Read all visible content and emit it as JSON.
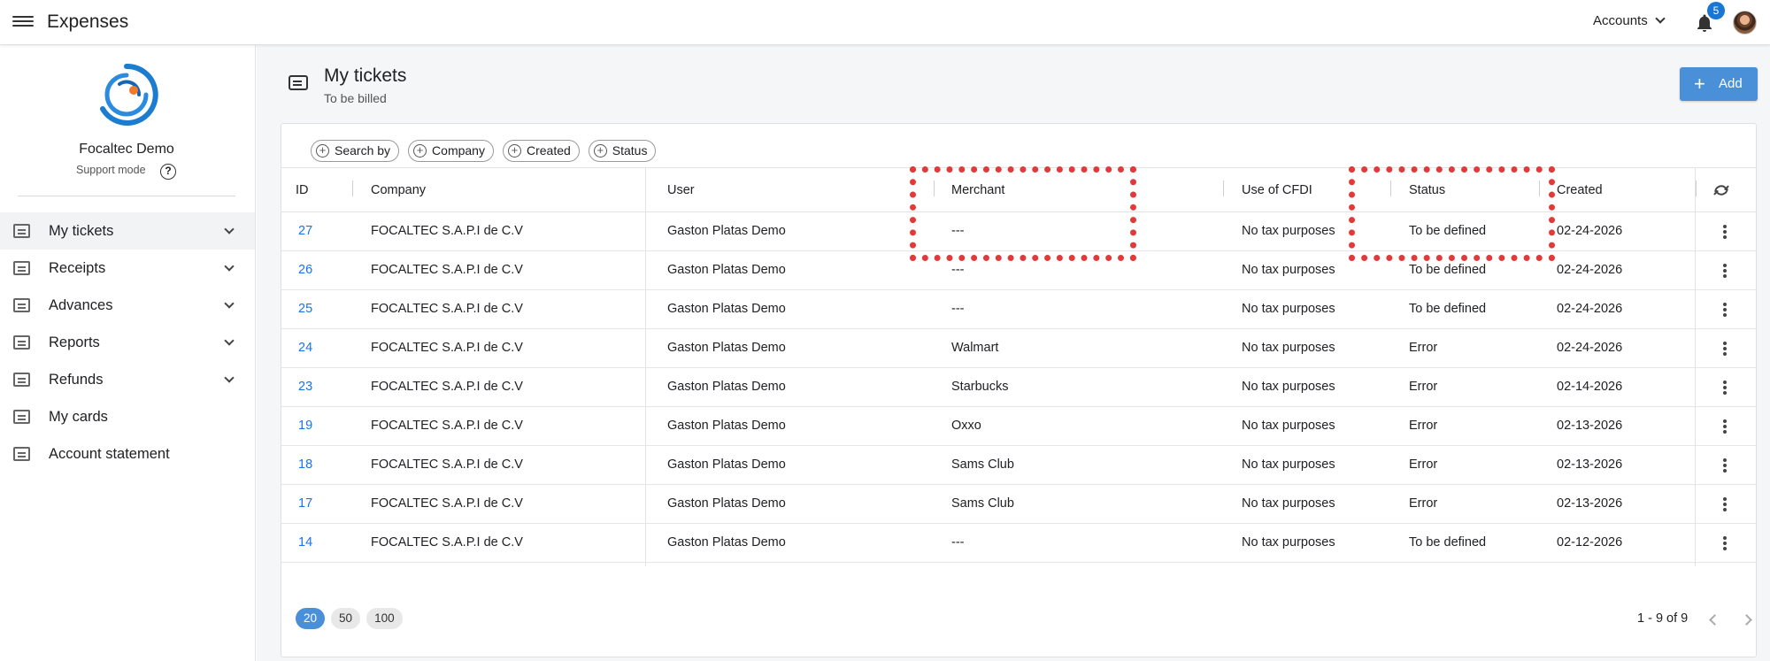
{
  "topbar": {
    "app_title": "Expenses",
    "accounts_label": "Accounts",
    "notification_count": "5"
  },
  "sidebar": {
    "org_name": "Focaltec Demo",
    "support_label": "Support mode",
    "help_glyph": "?",
    "items": [
      {
        "label": "My tickets",
        "icon": "ticket-icon",
        "expandable": true,
        "active": true
      },
      {
        "label": "Receipts",
        "icon": "receipt-icon",
        "expandable": true
      },
      {
        "label": "Advances",
        "icon": "cash-icon",
        "expandable": true
      },
      {
        "label": "Reports",
        "icon": "report-icon",
        "expandable": true
      },
      {
        "label": "Refunds",
        "icon": "refund-icon",
        "expandable": true
      },
      {
        "label": "My cards",
        "icon": "card-icon",
        "expandable": false
      },
      {
        "label": "Account statement",
        "icon": "wallet-icon",
        "expandable": false
      }
    ]
  },
  "page": {
    "title": "My tickets",
    "subtitle": "To be billed",
    "add_label": "Add"
  },
  "filters": [
    "Search by",
    "Company",
    "Created",
    "Status"
  ],
  "table": {
    "columns": [
      "ID",
      "Company",
      "User",
      "Merchant",
      "Use of CFDI",
      "Status",
      "Created"
    ],
    "rows": [
      {
        "id": "27",
        "company": "FOCALTEC S.A.P.I de C.V",
        "user": "Gaston Platas Demo",
        "merchant": "---",
        "cfdi": "No tax purposes",
        "status": "To be defined",
        "created": "02-24-2026"
      },
      {
        "id": "26",
        "company": "FOCALTEC S.A.P.I de C.V",
        "user": "Gaston Platas Demo",
        "merchant": "---",
        "cfdi": "No tax purposes",
        "status": "To be defined",
        "created": "02-24-2026"
      },
      {
        "id": "25",
        "company": "FOCALTEC S.A.P.I de C.V",
        "user": "Gaston Platas Demo",
        "merchant": "---",
        "cfdi": "No tax purposes",
        "status": "To be defined",
        "created": "02-24-2026"
      },
      {
        "id": "24",
        "company": "FOCALTEC S.A.P.I de C.V",
        "user": "Gaston Platas Demo",
        "merchant": "Walmart",
        "cfdi": "No tax purposes",
        "status": "Error",
        "created": "02-24-2026"
      },
      {
        "id": "23",
        "company": "FOCALTEC S.A.P.I de C.V",
        "user": "Gaston Platas Demo",
        "merchant": "Starbucks",
        "cfdi": "No tax purposes",
        "status": "Error",
        "created": "02-14-2026"
      },
      {
        "id": "19",
        "company": "FOCALTEC S.A.P.I de C.V",
        "user": "Gaston Platas Demo",
        "merchant": "Oxxo",
        "cfdi": "No tax purposes",
        "status": "Error",
        "created": "02-13-2026"
      },
      {
        "id": "18",
        "company": "FOCALTEC S.A.P.I de C.V",
        "user": "Gaston Platas Demo",
        "merchant": "Sams Club",
        "cfdi": "No tax purposes",
        "status": "Error",
        "created": "02-13-2026"
      },
      {
        "id": "17",
        "company": "FOCALTEC S.A.P.I de C.V",
        "user": "Gaston Platas Demo",
        "merchant": "Sams Club",
        "cfdi": "No tax purposes",
        "status": "Error",
        "created": "02-13-2026"
      },
      {
        "id": "14",
        "company": "FOCALTEC S.A.P.I de C.V",
        "user": "Gaston Platas Demo",
        "merchant": "---",
        "cfdi": "No tax purposes",
        "status": "To be defined",
        "created": "02-12-2026"
      }
    ]
  },
  "pagination": {
    "page_sizes": [
      "20",
      "50",
      "100"
    ],
    "selected_size": "20",
    "range_text": "1 - 9 of 9"
  },
  "colors": {
    "accent": "#4a90d9",
    "link": "#1a73e8",
    "annotation": "#e03a3a"
  }
}
